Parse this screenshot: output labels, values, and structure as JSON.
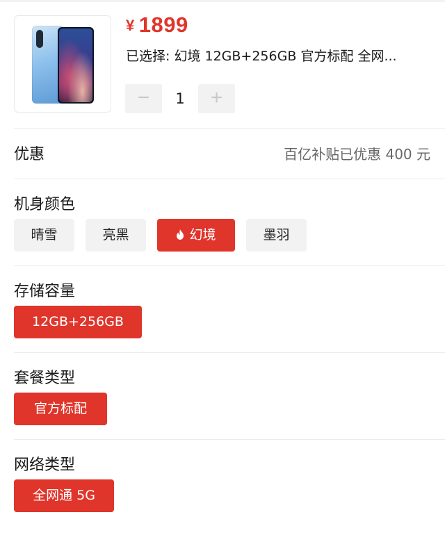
{
  "product": {
    "price_symbol": "¥",
    "price": "1899",
    "selected_text": "已选择: 幻境 12GB+256GB 官方标配 全网...",
    "quantity": "1",
    "minus_label": "−",
    "plus_label": "+"
  },
  "discount": {
    "label": "优惠",
    "value": "百亿补贴已优惠 400 元"
  },
  "color_section": {
    "title": "机身颜色",
    "options": [
      "晴雪",
      "亮黑",
      "幻境",
      "墨羽"
    ],
    "selected": "幻境"
  },
  "storage_section": {
    "title": "存储容量",
    "options": [
      "12GB+256GB"
    ],
    "selected": "12GB+256GB"
  },
  "package_section": {
    "title": "套餐类型",
    "options": [
      "官方标配"
    ],
    "selected": "官方标配"
  },
  "network_section": {
    "title": "网络类型",
    "options": [
      "全网通 5G"
    ],
    "selected": "全网通 5G"
  },
  "colors": {
    "accent": "#e0352b",
    "chip_bg": "#f2f2f2"
  }
}
